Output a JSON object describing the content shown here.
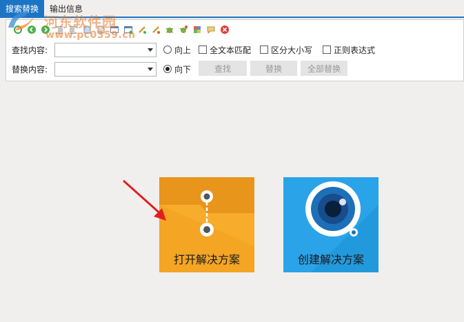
{
  "tabs": [
    {
      "label": "搜索替换",
      "active": true
    },
    {
      "label": "输出信息",
      "active": false
    }
  ],
  "watermark": {
    "title": "河东软件园",
    "url": "www.pc0359.cn"
  },
  "toolbar": {
    "icons": [
      "refresh-icon",
      "back-icon",
      "forward-icon",
      "indent-icon",
      "outdent-icon",
      "bookmark-icon",
      "bookmark-next-icon",
      "window-icon",
      "window-add-icon",
      "link-icon",
      "link-edit-icon",
      "bug-icon",
      "bug-add-icon",
      "plugin-icon",
      "comment-icon",
      "close-red-icon"
    ]
  },
  "search": {
    "find_label": "查找内容:",
    "find_value": "",
    "replace_label": "替换内容:",
    "replace_value": "",
    "direction_up": "向上",
    "direction_down": "向下",
    "direction_selected": "down",
    "whole_word": "全文本匹配",
    "match_case": "区分大小写",
    "regex": "正则表达式",
    "find_button": "查找",
    "replace_button": "替换",
    "replace_all_button": "全部替换"
  },
  "tiles": {
    "open_label": "打开解决方案",
    "create_label": "创建解决方案"
  },
  "colors": {
    "tab_active": "#1c74c4",
    "tile_open": "#f4a21f",
    "tile_create": "#2aa3e8",
    "annotation_arrow": "#e0201e"
  }
}
